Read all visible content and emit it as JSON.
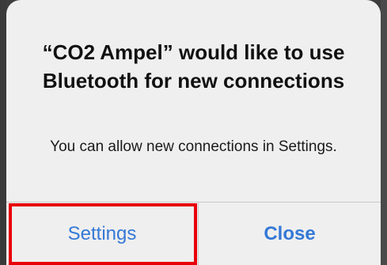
{
  "alert": {
    "title": "“CO2 Ampel” would like to use Bluetooth for new connections",
    "message": "You can allow new connections in Settings.",
    "buttons": {
      "settings_label": "Settings",
      "close_label": "Close"
    }
  },
  "annotation": {
    "highlight_color": "#e8000b"
  },
  "colors": {
    "button_text": "#3478d6",
    "alert_background": "#efefef"
  }
}
